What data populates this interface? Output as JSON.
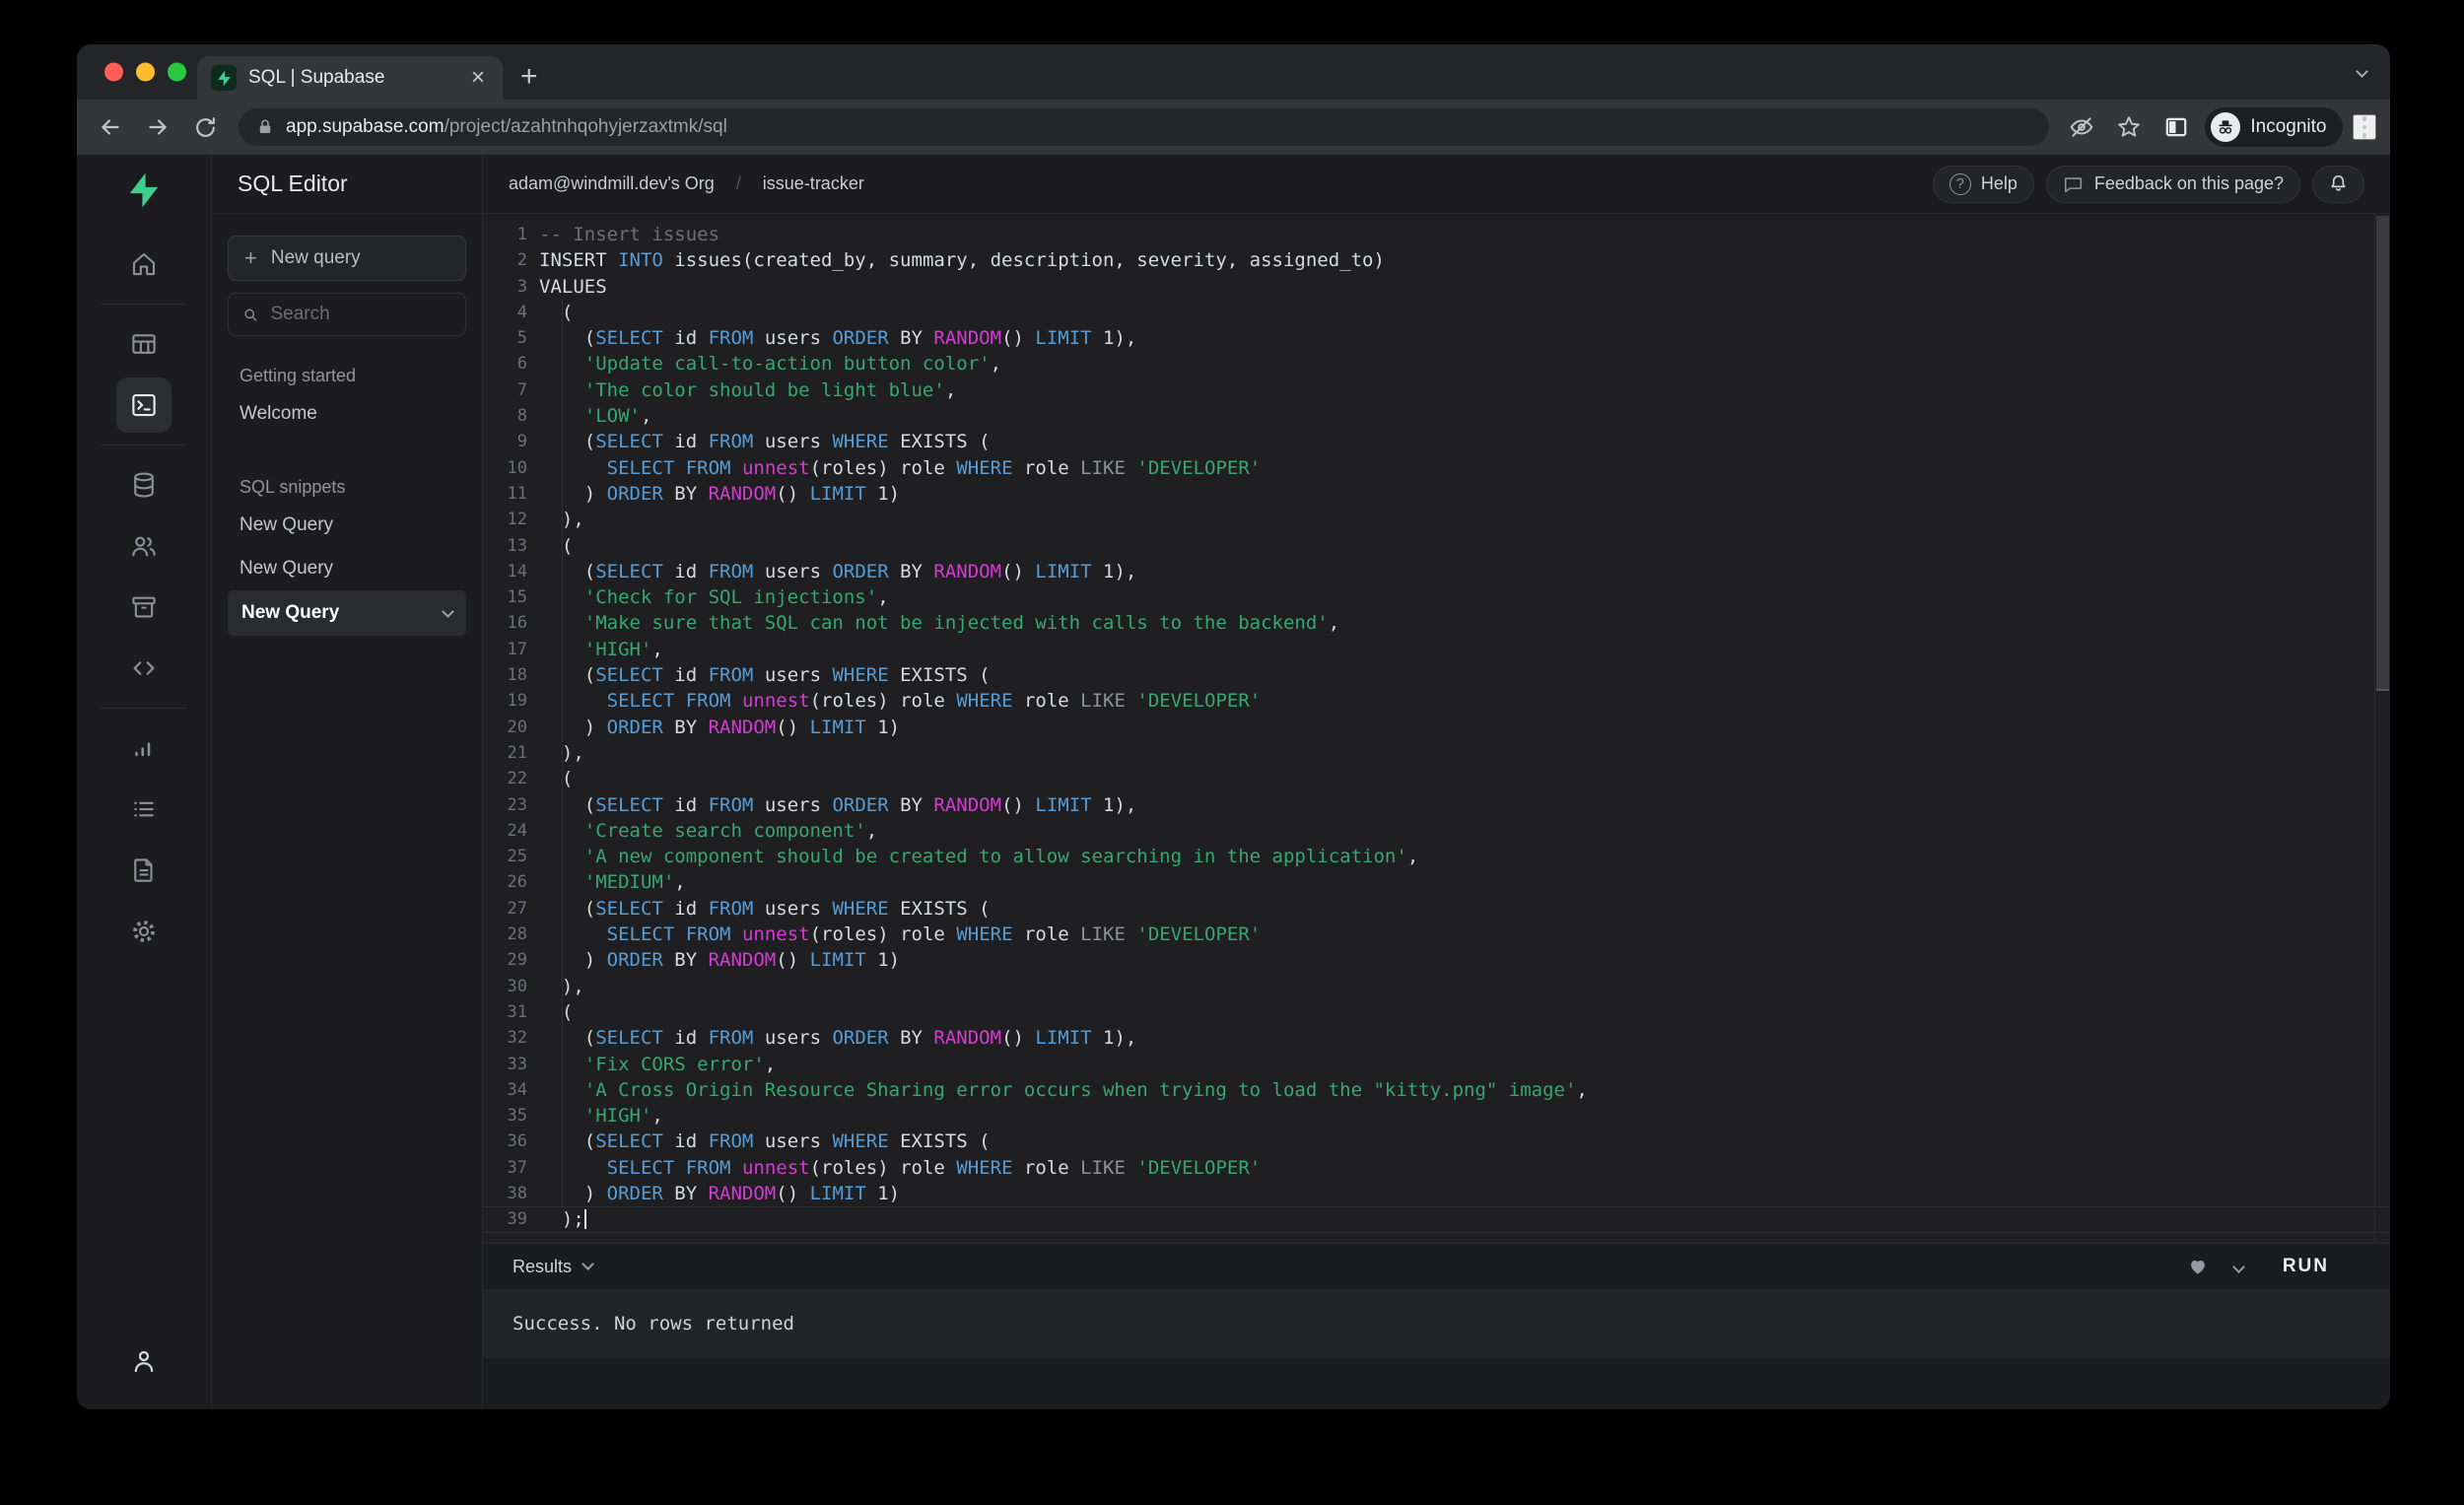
{
  "browser": {
    "tab_title": "SQL | Supabase",
    "close_glyph": "×",
    "new_tab_glyph": "+",
    "url_host": "app.supabase.com",
    "url_path": "/project/azahtnhqohyjerzaxtmk/sql",
    "incognito_label": "Incognito"
  },
  "header": {
    "breadcrumb_org": "adam@windmill.dev's Org",
    "breadcrumb_sep": "/",
    "breadcrumb_project": "issue-tracker",
    "help_label": "Help",
    "help_glyph": "?",
    "feedback_label": "Feedback on this page?"
  },
  "sidebar": {
    "title": "SQL Editor",
    "new_query_button": "New query",
    "new_query_plus": "+",
    "search_placeholder": "Search",
    "sections": [
      {
        "label": "Getting started",
        "items": [
          {
            "label": "Welcome"
          }
        ]
      },
      {
        "label": "SQL snippets",
        "items": [
          {
            "label": "New Query"
          },
          {
            "label": "New Query"
          },
          {
            "label": "New Query",
            "active": true
          }
        ]
      }
    ]
  },
  "icons": [
    "supabase-logo",
    "home-icon",
    "table-editor-icon",
    "sql-editor-icon",
    "database-icon",
    "auth-users-icon",
    "storage-icon",
    "edge-functions-icon",
    "reports-icon",
    "logs-icon",
    "docs-icon",
    "settings-gear-icon",
    "account-icon",
    "lock-icon",
    "eye-blocked-icon",
    "star-icon",
    "side-panel-icon",
    "incognito-icon",
    "kebab-menu-icon",
    "help-circle-icon",
    "chat-bubble-icon",
    "bell-icon",
    "heart-icon",
    "chevron-down-icon",
    "back-arrow-icon",
    "forward-arrow-icon",
    "reload-icon",
    "search-icon",
    "close-icon",
    "plus-icon"
  ],
  "colors": {
    "accent_green": "#3ECF8E",
    "keyword_blue": "#569CD6",
    "function_magenta": "#D33BD3",
    "string_green": "#36A672",
    "comment_gray": "#6A7077",
    "editor_bg": "#1F1F21",
    "panel_bg": "#1C1C1E"
  },
  "editor": {
    "cursor_line": 39,
    "lines": [
      [
        [
          "c",
          "-- Insert issues"
        ]
      ],
      [
        [
          "w",
          "INSERT "
        ],
        [
          "b",
          "INTO"
        ],
        [
          "w",
          " issues(created_by, summary, description, severity, assigned_to)"
        ]
      ],
      [
        [
          "w",
          "VALUES"
        ]
      ],
      [
        [
          "w",
          "  ("
        ]
      ],
      [
        [
          "w",
          "    ("
        ],
        [
          "b",
          "SELECT"
        ],
        [
          "w",
          " id "
        ],
        [
          "b",
          "FROM"
        ],
        [
          "w",
          " users "
        ],
        [
          "b",
          "ORDER"
        ],
        [
          "w",
          " BY "
        ],
        [
          "m",
          "RANDOM"
        ],
        [
          "w",
          "() "
        ],
        [
          "b",
          "LIMIT"
        ],
        [
          "w",
          " 1),"
        ]
      ],
      [
        [
          "w",
          "    "
        ],
        [
          "s",
          "'Update call-to-action button color'"
        ],
        [
          "w",
          ","
        ]
      ],
      [
        [
          "w",
          "    "
        ],
        [
          "s",
          "'The color should be light blue'"
        ],
        [
          "w",
          ","
        ]
      ],
      [
        [
          "w",
          "    "
        ],
        [
          "s",
          "'LOW'"
        ],
        [
          "w",
          ","
        ]
      ],
      [
        [
          "w",
          "    ("
        ],
        [
          "b",
          "SELECT"
        ],
        [
          "w",
          " id "
        ],
        [
          "b",
          "FROM"
        ],
        [
          "w",
          " users "
        ],
        [
          "b",
          "WHERE"
        ],
        [
          "w",
          " EXISTS ("
        ]
      ],
      [
        [
          "w",
          "      "
        ],
        [
          "b",
          "SELECT"
        ],
        [
          "w",
          " "
        ],
        [
          "b",
          "FROM"
        ],
        [
          "w",
          " "
        ],
        [
          "m",
          "unnest"
        ],
        [
          "w",
          "(roles) role "
        ],
        [
          "b",
          "WHERE"
        ],
        [
          "w",
          " role "
        ],
        [
          "g",
          "LIKE"
        ],
        [
          "w",
          " "
        ],
        [
          "s",
          "'DEVELOPER'"
        ]
      ],
      [
        [
          "w",
          "    ) "
        ],
        [
          "b",
          "ORDER"
        ],
        [
          "w",
          " BY "
        ],
        [
          "m",
          "RANDOM"
        ],
        [
          "w",
          "() "
        ],
        [
          "b",
          "LIMIT"
        ],
        [
          "w",
          " 1)"
        ]
      ],
      [
        [
          "w",
          "  ),"
        ]
      ],
      [
        [
          "w",
          "  ("
        ]
      ],
      [
        [
          "w",
          "    ("
        ],
        [
          "b",
          "SELECT"
        ],
        [
          "w",
          " id "
        ],
        [
          "b",
          "FROM"
        ],
        [
          "w",
          " users "
        ],
        [
          "b",
          "ORDER"
        ],
        [
          "w",
          " BY "
        ],
        [
          "m",
          "RANDOM"
        ],
        [
          "w",
          "() "
        ],
        [
          "b",
          "LIMIT"
        ],
        [
          "w",
          " 1),"
        ]
      ],
      [
        [
          "w",
          "    "
        ],
        [
          "s",
          "'Check for SQL injections'"
        ],
        [
          "w",
          ","
        ]
      ],
      [
        [
          "w",
          "    "
        ],
        [
          "s",
          "'Make sure that SQL can not be injected with calls to the backend'"
        ],
        [
          "w",
          ","
        ]
      ],
      [
        [
          "w",
          "    "
        ],
        [
          "s",
          "'HIGH'"
        ],
        [
          "w",
          ","
        ]
      ],
      [
        [
          "w",
          "    ("
        ],
        [
          "b",
          "SELECT"
        ],
        [
          "w",
          " id "
        ],
        [
          "b",
          "FROM"
        ],
        [
          "w",
          " users "
        ],
        [
          "b",
          "WHERE"
        ],
        [
          "w",
          " EXISTS ("
        ]
      ],
      [
        [
          "w",
          "      "
        ],
        [
          "b",
          "SELECT"
        ],
        [
          "w",
          " "
        ],
        [
          "b",
          "FROM"
        ],
        [
          "w",
          " "
        ],
        [
          "m",
          "unnest"
        ],
        [
          "w",
          "(roles) role "
        ],
        [
          "b",
          "WHERE"
        ],
        [
          "w",
          " role "
        ],
        [
          "g",
          "LIKE"
        ],
        [
          "w",
          " "
        ],
        [
          "s",
          "'DEVELOPER'"
        ]
      ],
      [
        [
          "w",
          "    ) "
        ],
        [
          "b",
          "ORDER"
        ],
        [
          "w",
          " BY "
        ],
        [
          "m",
          "RANDOM"
        ],
        [
          "w",
          "() "
        ],
        [
          "b",
          "LIMIT"
        ],
        [
          "w",
          " 1)"
        ]
      ],
      [
        [
          "w",
          "  ),"
        ]
      ],
      [
        [
          "w",
          "  ("
        ]
      ],
      [
        [
          "w",
          "    ("
        ],
        [
          "b",
          "SELECT"
        ],
        [
          "w",
          " id "
        ],
        [
          "b",
          "FROM"
        ],
        [
          "w",
          " users "
        ],
        [
          "b",
          "ORDER"
        ],
        [
          "w",
          " BY "
        ],
        [
          "m",
          "RANDOM"
        ],
        [
          "w",
          "() "
        ],
        [
          "b",
          "LIMIT"
        ],
        [
          "w",
          " 1),"
        ]
      ],
      [
        [
          "w",
          "    "
        ],
        [
          "s",
          "'Create search component'"
        ],
        [
          "w",
          ","
        ]
      ],
      [
        [
          "w",
          "    "
        ],
        [
          "s",
          "'A new component should be created to allow searching in the application'"
        ],
        [
          "w",
          ","
        ]
      ],
      [
        [
          "w",
          "    "
        ],
        [
          "s",
          "'MEDIUM'"
        ],
        [
          "w",
          ","
        ]
      ],
      [
        [
          "w",
          "    ("
        ],
        [
          "b",
          "SELECT"
        ],
        [
          "w",
          " id "
        ],
        [
          "b",
          "FROM"
        ],
        [
          "w",
          " users "
        ],
        [
          "b",
          "WHERE"
        ],
        [
          "w",
          " EXISTS ("
        ]
      ],
      [
        [
          "w",
          "      "
        ],
        [
          "b",
          "SELECT"
        ],
        [
          "w",
          " "
        ],
        [
          "b",
          "FROM"
        ],
        [
          "w",
          " "
        ],
        [
          "m",
          "unnest"
        ],
        [
          "w",
          "(roles) role "
        ],
        [
          "b",
          "WHERE"
        ],
        [
          "w",
          " role "
        ],
        [
          "g",
          "LIKE"
        ],
        [
          "w",
          " "
        ],
        [
          "s",
          "'DEVELOPER'"
        ]
      ],
      [
        [
          "w",
          "    ) "
        ],
        [
          "b",
          "ORDER"
        ],
        [
          "w",
          " BY "
        ],
        [
          "m",
          "RANDOM"
        ],
        [
          "w",
          "() "
        ],
        [
          "b",
          "LIMIT"
        ],
        [
          "w",
          " 1)"
        ]
      ],
      [
        [
          "w",
          "  ),"
        ]
      ],
      [
        [
          "w",
          "  ("
        ]
      ],
      [
        [
          "w",
          "    ("
        ],
        [
          "b",
          "SELECT"
        ],
        [
          "w",
          " id "
        ],
        [
          "b",
          "FROM"
        ],
        [
          "w",
          " users "
        ],
        [
          "b",
          "ORDER"
        ],
        [
          "w",
          " BY "
        ],
        [
          "m",
          "RANDOM"
        ],
        [
          "w",
          "() "
        ],
        [
          "b",
          "LIMIT"
        ],
        [
          "w",
          " 1),"
        ]
      ],
      [
        [
          "w",
          "    "
        ],
        [
          "s",
          "'Fix CORS error'"
        ],
        [
          "w",
          ","
        ]
      ],
      [
        [
          "w",
          "    "
        ],
        [
          "s",
          "'A Cross Origin Resource Sharing error occurs when trying to load the \"kitty.png\" image'"
        ],
        [
          "w",
          ","
        ]
      ],
      [
        [
          "w",
          "    "
        ],
        [
          "s",
          "'HIGH'"
        ],
        [
          "w",
          ","
        ]
      ],
      [
        [
          "w",
          "    ("
        ],
        [
          "b",
          "SELECT"
        ],
        [
          "w",
          " id "
        ],
        [
          "b",
          "FROM"
        ],
        [
          "w",
          " users "
        ],
        [
          "b",
          "WHERE"
        ],
        [
          "w",
          " EXISTS ("
        ]
      ],
      [
        [
          "w",
          "      "
        ],
        [
          "b",
          "SELECT"
        ],
        [
          "w",
          " "
        ],
        [
          "b",
          "FROM"
        ],
        [
          "w",
          " "
        ],
        [
          "m",
          "unnest"
        ],
        [
          "w",
          "(roles) role "
        ],
        [
          "b",
          "WHERE"
        ],
        [
          "w",
          " role "
        ],
        [
          "g",
          "LIKE"
        ],
        [
          "w",
          " "
        ],
        [
          "s",
          "'DEVELOPER'"
        ]
      ],
      [
        [
          "w",
          "    ) "
        ],
        [
          "b",
          "ORDER"
        ],
        [
          "w",
          " BY "
        ],
        [
          "m",
          "RANDOM"
        ],
        [
          "w",
          "() "
        ],
        [
          "b",
          "LIMIT"
        ],
        [
          "w",
          " 1)"
        ]
      ],
      [
        [
          "w",
          "  );"
        ]
      ]
    ]
  },
  "results": {
    "bar_label": "Results",
    "run_label": "RUN",
    "status_text": "Success. No rows returned"
  }
}
